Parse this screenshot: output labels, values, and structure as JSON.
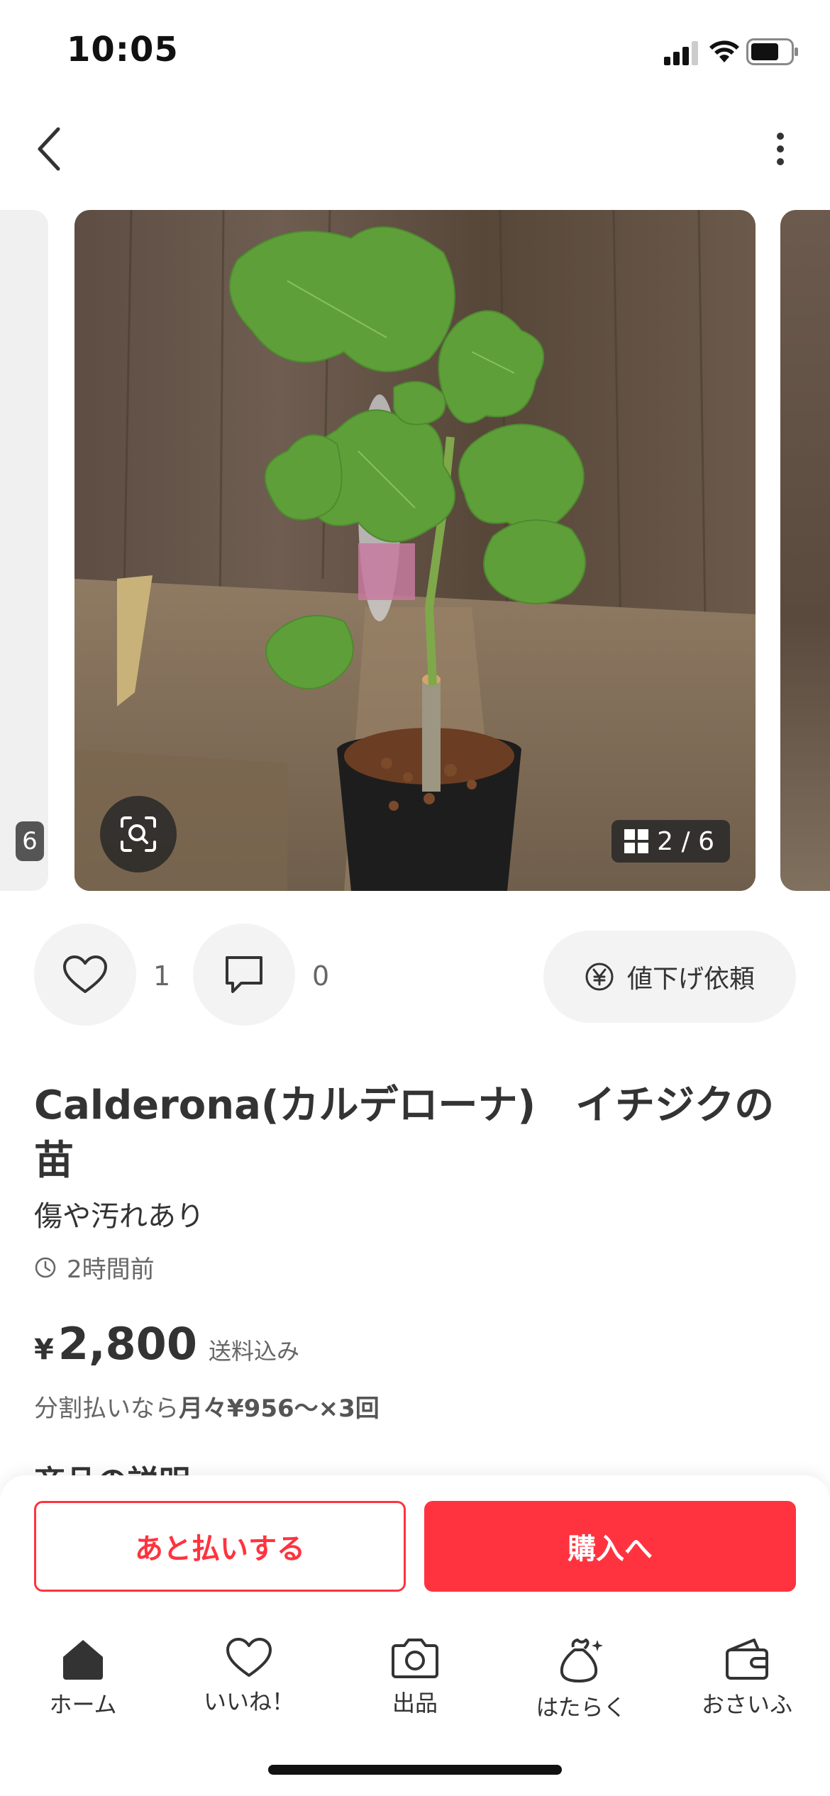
{
  "status_bar": {
    "time": "10:05"
  },
  "carousel": {
    "counter": "2 / 6",
    "left_peek_counter": "6"
  },
  "actions": {
    "likes": "1",
    "comments": "0",
    "price_request_label": "値下げ依頼"
  },
  "item": {
    "title": "Calderona(カルデローナ)　イチジクの苗",
    "condition": "傷や汚れあり",
    "posted": "2時間前",
    "currency": "¥",
    "price": "2,800",
    "shipping": "送料込み",
    "installment_prefix": "分割払いなら",
    "installment_value": "月々¥956～×3回",
    "section_heading": "商品の説明"
  },
  "buttons": {
    "pay_later": "あと払いする",
    "buy": "購入へ"
  },
  "tabs": [
    {
      "label": "ホーム",
      "icon": "home-icon"
    },
    {
      "label": "いいね！",
      "icon": "heart-icon"
    },
    {
      "label": "出品",
      "icon": "camera-icon"
    },
    {
      "label": "はたらく",
      "icon": "money-bag-icon"
    },
    {
      "label": "おさいふ",
      "icon": "wallet-icon"
    }
  ],
  "colors": {
    "accent": "#ff333f",
    "text": "#333333",
    "muted": "#666666",
    "chip_bg": "#f3f3f3"
  }
}
